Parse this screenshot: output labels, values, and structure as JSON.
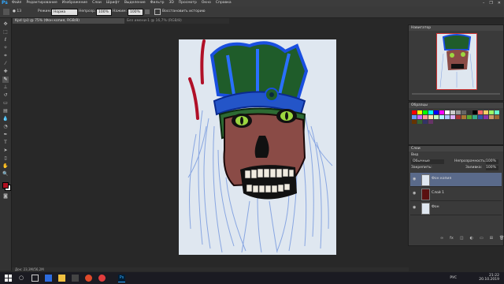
{
  "app": {
    "logo": "Ps",
    "menus": [
      "Файл",
      "Редактирование",
      "Изображение",
      "Слои",
      "Шрифт",
      "Выделение",
      "Фильтр",
      "3D",
      "Просмотр",
      "Окно",
      "Справка"
    ],
    "window_controls": [
      "–",
      "❐",
      "✕"
    ]
  },
  "options": {
    "mode_label": "Режим:",
    "mode_value": "Норма",
    "opacity_label": "Непрозр.:",
    "opacity_value": "100%",
    "flow_label": "Нажим:",
    "flow_value": "100%",
    "smoothing_label": "Восстановить историю"
  },
  "document": {
    "tab_active": "Kpd (pi) @ 75% (Фон копия, RGB/8)",
    "tab_inactive": "Без имени-1 @ 16,7% (RGB/8)",
    "status": "Док: 23,3M/56,2M"
  },
  "panels": {
    "navigator_title": "Навигатор",
    "swatches_title": "Образцы",
    "layers_title": "Слои",
    "layers_kind": "Вид",
    "blend_mode": "Обычные",
    "opacity_label": "Непрозрачность:",
    "opacity_value": "100%",
    "fill_label": "Заливка:",
    "fill_value": "100%",
    "lock_label": "Закрепить:",
    "layers": [
      {
        "name": "Фон копия"
      },
      {
        "name": "Слой 1"
      },
      {
        "name": "Фон"
      }
    ]
  },
  "taskbar": {
    "language": "РУС",
    "time": "21:22",
    "date": "20.10.2019"
  },
  "colors": {
    "accent": "#31a8ff",
    "foreground": "#b01020",
    "background": "#ffffff"
  }
}
